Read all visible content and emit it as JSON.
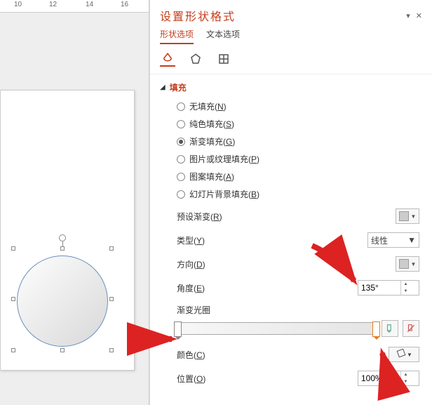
{
  "ruler": {
    "t10": "10",
    "t12": "12",
    "t14": "14",
    "t16": "16"
  },
  "panel": {
    "title": "设置形状格式",
    "tabs": {
      "shape": "形状选项",
      "text": "文本选项"
    },
    "section_fill": "填充",
    "radios": {
      "none": "无填充(",
      "none_k": "N",
      "none_tail": ")",
      "solid": "纯色填充(",
      "solid_k": "S",
      "solid_tail": ")",
      "gradient": "渐变填充(",
      "gradient_k": "G",
      "gradient_tail": ")",
      "picture": "图片或纹理填充(",
      "picture_k": "P",
      "picture_tail": ")",
      "pattern": "图案填充(",
      "pattern_k": "A",
      "pattern_tail": ")",
      "slidebg": "幻灯片背景填充(",
      "slidebg_k": "B",
      "slidebg_tail": ")"
    },
    "labels": {
      "preset": "预设渐变(",
      "preset_k": "R",
      "preset_tail": ")",
      "type": "类型(",
      "type_k": "Y",
      "type_tail": ")",
      "direction": "方向(",
      "direction_k": "D",
      "direction_tail": ")",
      "angle": "角度(",
      "angle_k": "E",
      "angle_tail": ")",
      "stops": "渐变光圈",
      "color": "颜色(",
      "color_k": "C",
      "color_tail": ")",
      "position": "位置(",
      "position_k": "O",
      "position_tail": ")"
    },
    "values": {
      "type_value": "线性",
      "angle_value": "135°",
      "position_value": "100%"
    }
  }
}
